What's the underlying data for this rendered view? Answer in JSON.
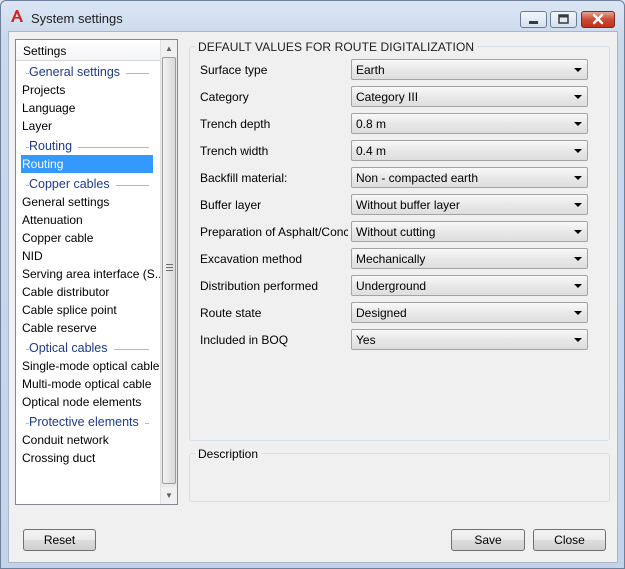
{
  "window": {
    "title": "System settings"
  },
  "nav": {
    "header": "Settings",
    "entries": [
      {
        "type": "group",
        "label": "General settings"
      },
      {
        "type": "item",
        "label": "Projects"
      },
      {
        "type": "item",
        "label": "Language"
      },
      {
        "type": "item",
        "label": "Layer"
      },
      {
        "type": "group",
        "label": "Routing"
      },
      {
        "type": "item",
        "label": "Routing",
        "selected": true
      },
      {
        "type": "group",
        "label": "Copper cables"
      },
      {
        "type": "item",
        "label": "General settings"
      },
      {
        "type": "item",
        "label": "Attenuation"
      },
      {
        "type": "item",
        "label": "Copper cable"
      },
      {
        "type": "item",
        "label": "NID"
      },
      {
        "type": "item",
        "label": "Serving area interface (S..."
      },
      {
        "type": "item",
        "label": "Cable distributor"
      },
      {
        "type": "item",
        "label": "Cable splice point"
      },
      {
        "type": "item",
        "label": "Cable reserve"
      },
      {
        "type": "group",
        "label": "Optical cables"
      },
      {
        "type": "item",
        "label": "Single-mode optical cable"
      },
      {
        "type": "item",
        "label": "Multi-mode optical cable"
      },
      {
        "type": "item",
        "label": "Optical node elements"
      },
      {
        "type": "group",
        "label": "Protective elements"
      },
      {
        "type": "item",
        "label": "Conduit network"
      },
      {
        "type": "item",
        "label": "Crossing duct"
      }
    ]
  },
  "form": {
    "group_title": "DEFAULT VALUES FOR ROUTE DIGITALIZATION",
    "fields": [
      {
        "label": "Surface type",
        "value": "Earth"
      },
      {
        "label": "Category",
        "value": "Category III"
      },
      {
        "label": "Trench depth",
        "value": "0.8 m"
      },
      {
        "label": "Trench width",
        "value": "0.4 m"
      },
      {
        "label": "Backfill material:",
        "value": "Non - compacted earth"
      },
      {
        "label": "Buffer layer",
        "value": "Without buffer layer"
      },
      {
        "label": "Preparation of Asphalt/Concrete",
        "value": "Without cutting"
      },
      {
        "label": "Excavation method",
        "value": "Mechanically"
      },
      {
        "label": "Distribution performed",
        "value": "Underground"
      },
      {
        "label": "Route state",
        "value": "Designed"
      },
      {
        "label": "Included in BOQ",
        "value": "Yes"
      }
    ]
  },
  "description": {
    "title": "Description"
  },
  "buttons": {
    "reset": "Reset",
    "save": "Save",
    "close": "Close"
  },
  "colors": {
    "selection": "#3399ff",
    "group_label": "#1f3b8a",
    "close_button": "#c0301c"
  }
}
